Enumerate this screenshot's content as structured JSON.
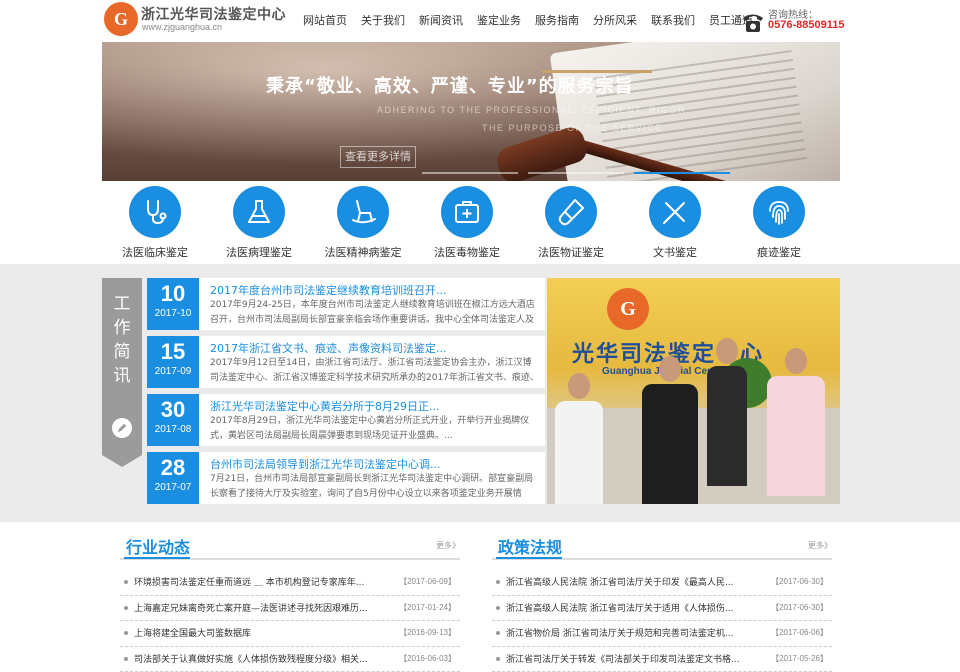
{
  "header": {
    "logo_letter": "G",
    "title": "浙江光华司法鉴定中心",
    "url": "www.zjguanghua.cn",
    "nav": [
      "网站首页",
      "关于我们",
      "新闻资讯",
      "鉴定业务",
      "服务指南",
      "分所风采",
      "联系我们",
      "员工通道"
    ],
    "hotline_label": "咨询热线：",
    "hotline_number": "0576-88509115"
  },
  "banner": {
    "slogan": "秉承“敬业、高效、严谨、专业”的服务宗旨",
    "subtitle_line1": "ADHERING TO THE PROFESSIONAL, EFFICIENT, RIGOR",
    "subtitle_line2": "THE PURPOSE OF THE SERVICE",
    "more_button": "查看更多详情",
    "slide_count": 3,
    "active_slide": 3
  },
  "services": [
    {
      "label": "法医临床鉴定",
      "icon": "stethoscope-icon"
    },
    {
      "label": "法医病理鉴定",
      "icon": "flask-icon"
    },
    {
      "label": "法医精神病鉴定",
      "icon": "rocking-chair-icon"
    },
    {
      "label": "法医毒物鉴定",
      "icon": "medical-kit-icon"
    },
    {
      "label": "法医物证鉴定",
      "icon": "test-tube-icon"
    },
    {
      "label": "文书鉴定",
      "icon": "pen-ruler-icon"
    },
    {
      "label": "痕迹鉴定",
      "icon": "fingerprint-icon"
    }
  ],
  "work_news": {
    "tag": "工作简讯",
    "items": [
      {
        "day": "10",
        "year_month": "2017-10",
        "title": "2017年度台州市司法鉴定继续教育培训班召开...",
        "summary": "2017年9月24-25日，本年度台州市司法鉴定人继续教育培训班在椒江方远大酒店召开，台州市司法局副局长部宣豪亲临会场作重要讲话。我中心全体司法鉴定人及助"
      },
      {
        "day": "15",
        "year_month": "2017-09",
        "title": "2017年浙江省文书、痕迹、声像资料司法鉴定...",
        "summary": "2017年9月12日至14日，由浙江省司法厅、浙江省司法鉴定协会主办，浙江汉博司法鉴定中心、浙江省汉博鉴定科学技术研究所承办的2017年浙江省文书、痕迹、声"
      },
      {
        "day": "30",
        "year_month": "2017-08",
        "title": "浙江光华司法鉴定中心黄岩分所于8月29日正...",
        "summary": "2017年8月29日，浙江光华司法鉴定中心黄岩分所正式开业，开举行开业揭牌仪式，黄岩区司法局副局长周晨弹要恵到现场见证开业盛典。..."
      },
      {
        "day": "28",
        "year_month": "2017-07",
        "title": "台州市司法局领导到浙江光华司法鉴定中心调...",
        "summary": "7月21日，台州市司法局部宣豪副局长到浙江光华司法鉴定中心调研。部宣豪副局长察看了接待大厅及实验室，询问了自5月份中心设立以来各项鉴定业务开展情"
      }
    ]
  },
  "photo": {
    "sign_letter": "G",
    "sign_text": "光华司法鉴定中心",
    "sign_sub": "Guanghua Judicial Center"
  },
  "industry": {
    "title": "行业动态",
    "more": "更多》",
    "items": [
      {
        "text": "环境损害司法鉴定任重而道远 ＿ 本市机构登记专家库年...",
        "date": "【2017-06-09】"
      },
      {
        "text": "上海嘉定兄妹离奇死亡案开庭—法医讲述寻找死因艰难历...",
        "date": "【2017-01-24】"
      },
      {
        "text": "上海将建全国最大司鉴数据库",
        "date": "【2016-09-13】"
      },
      {
        "text": "司法部关于认真做好实施《人体损伤致残程度分级》相关...",
        "date": "【2016-06-03】"
      }
    ]
  },
  "policy": {
    "title": "政策法规",
    "more": "更多》",
    "items": [
      {
        "text": "浙江省高级人民法院 浙江省司法厅关于印发《最高人民...",
        "date": "【2017-06-30】"
      },
      {
        "text": "浙江省高级人民法院 浙江省司法厅关于适用《人体损伤...",
        "date": "【2017-06-30】"
      },
      {
        "text": "浙江省物价局 浙江省司法厅关于规范和完善司法鉴定机...",
        "date": "【2017-06-06】"
      },
      {
        "text": "浙江省司法厅关于转发《司法部关于印发司法鉴定文书格...",
        "date": "【2017-05-26】"
      }
    ]
  },
  "colors": {
    "accent": "#1a8ee1",
    "hotline": "#e02828",
    "logo": "#e8682a",
    "tag_gray": "#9b9b9b",
    "band_bg": "#ebebeb"
  }
}
